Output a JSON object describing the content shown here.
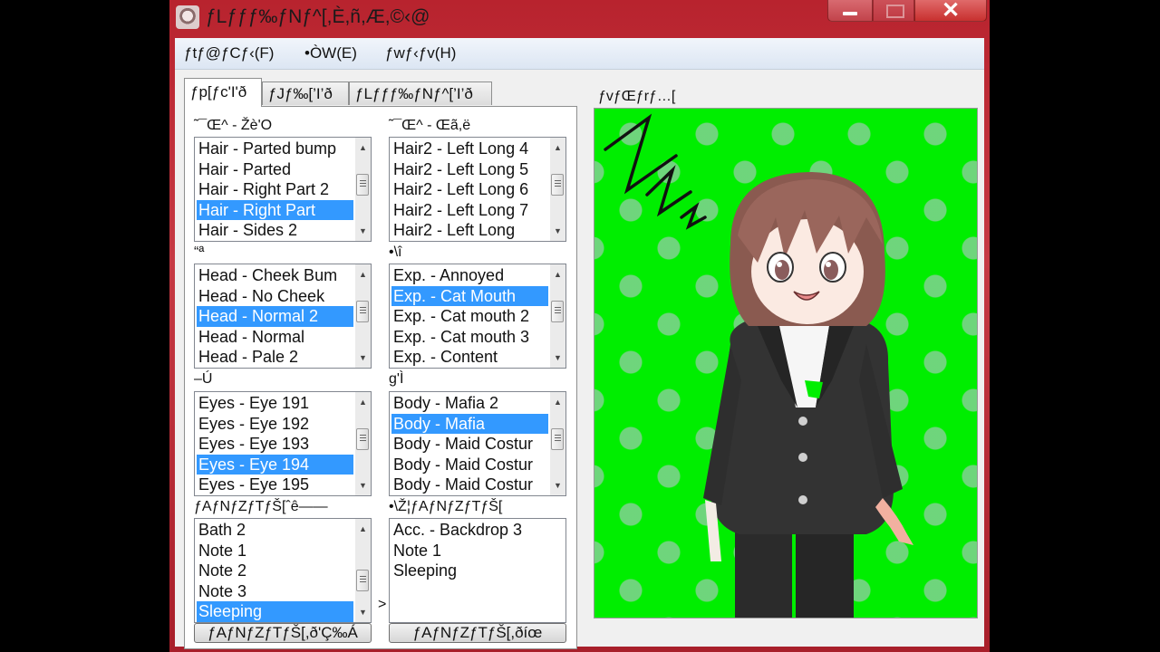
{
  "window": {
    "title": "ƒLƒƒƒ‰ƒNƒ^[,È,ñ,Æ,©‹@",
    "controls": {
      "minimize": "minimize",
      "maximize": "maximize",
      "close": "✕"
    }
  },
  "menubar": {
    "items": [
      {
        "label": "ƒtƒ@ƒCƒ‹(F)"
      },
      {
        "label": "•ÒW(E)"
      },
      {
        "label": "ƒwƒ‹ƒv(H)"
      }
    ]
  },
  "tabs": [
    {
      "label": "ƒp[ƒc'I'ð",
      "active": true
    },
    {
      "label": "ƒJƒ‰[’I’ð",
      "active": false
    },
    {
      "label": "ƒLƒƒƒ‰ƒNƒ^[’I’ð",
      "active": false
    }
  ],
  "groups": {
    "hair_front": {
      "label": "˜¯Œ^ - Žè'O",
      "items": [
        "Hair - Parted bump",
        "Hair - Parted",
        "Hair - Right Part 2",
        "Hair - Right Part",
        "Hair - Sides 2"
      ],
      "selected_index": 3
    },
    "hair_back": {
      "label": "˜¯Œ^ - Œã,ë",
      "items": [
        "Hair2 - Left Long 4",
        "Hair2 - Left Long 5",
        "Hair2 - Left Long 6",
        "Hair2 - Left Long 7",
        "Hair2 - Left Long"
      ],
      "selected_index": -1
    },
    "head": {
      "label": "“ª",
      "items": [
        "Head - Cheek Bum",
        "Head - No Cheek",
        "Head - Normal 2",
        "Head - Normal",
        "Head - Pale 2"
      ],
      "selected_index": 2
    },
    "expression": {
      "label": "•\\î",
      "items": [
        "Exp. - Annoyed",
        "Exp. - Cat Mouth",
        "Exp. - Cat mouth 2",
        "Exp. - Cat mouth 3",
        "Exp. - Content"
      ],
      "selected_index": 1
    },
    "eyes": {
      "label": "–Ú",
      "items": [
        "Eyes - Eye 191",
        "Eyes - Eye 192",
        "Eyes - Eye 193",
        "Eyes - Eye 194",
        "Eyes - Eye 195"
      ],
      "selected_index": 3
    },
    "body": {
      "label": "g'Ì",
      "items": [
        "Body - Mafia 2",
        "Body - Mafia",
        "Body - Maid Costur",
        "Body - Maid Costur",
        "Body - Maid Costur"
      ],
      "selected_index": 1
    },
    "accessory_list": {
      "label": "ƒAƒNƒZƒTƒŠ[ˆê——",
      "items": [
        "Bath 2",
        "Note 1",
        "Note 2",
        "Note 3",
        "Sleeping"
      ],
      "selected_index": 4
    },
    "accessory_equipped": {
      "label": "•\\Ž¦ƒAƒNƒZƒTƒŠ[",
      "items": [
        "Acc. - Backdrop 3",
        "Note 1",
        "Sleeping"
      ],
      "selected_index": -1
    }
  },
  "transfer_arrow": ">",
  "buttons": {
    "add_accessory": "ƒAƒNƒZƒTƒŠ[,ð'Ç‰Á",
    "remove_accessory": "ƒAƒNƒZƒTƒŠ[,ðíœ"
  },
  "preview": {
    "label": "ƒvƒŒƒrƒ…[",
    "background_color": "#00ee00",
    "character": "anime boy, brown hair, black suit, cat mouth, sleeping zzz mark"
  }
}
